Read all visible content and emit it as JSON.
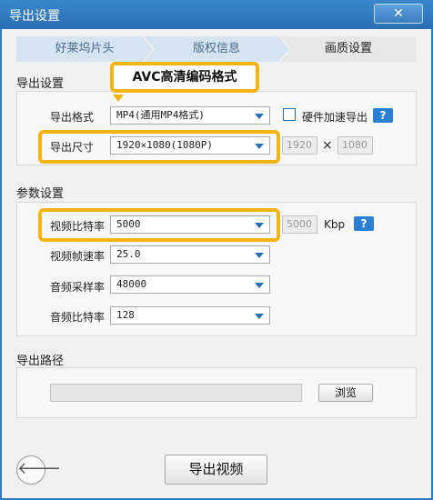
{
  "window": {
    "title": "导出设置",
    "close_glyph": "✕"
  },
  "steps": [
    "好莱坞片头",
    "版权信息",
    "画质设置"
  ],
  "callout": "AVC高清编码格式",
  "export_settings": {
    "section_title": "导出设置",
    "format_label": "导出格式",
    "format_value": "MP4(通用MP4格式)",
    "hw_accel_label": "硬件加速导出",
    "size_label": "导出尺寸",
    "size_value": "1920×1080(1080P)",
    "width_value": "1920",
    "times": "×",
    "height_value": "1080"
  },
  "params": {
    "section_title": "参数设置",
    "video_bitrate_label": "视频比特率",
    "video_bitrate_value": "5000",
    "bitrate_custom_value": "5000",
    "bitrate_unit": "Kbp",
    "fps_label": "视频帧速率",
    "fps_value": "25.0",
    "sample_rate_label": "音频采样率",
    "sample_rate_value": "48000",
    "audio_bitrate_label": "音频比特率",
    "audio_bitrate_value": "128"
  },
  "output_path": {
    "section_title": "导出路径",
    "path_value": "",
    "browse_label": "浏览"
  },
  "footer": {
    "export_video_label": "导出视频",
    "back_glyph": "🡐"
  },
  "help_glyph": "?",
  "colors": {
    "accent": "#2f79bd",
    "highlight": "#f4b414",
    "help": "#2b7fd3"
  }
}
